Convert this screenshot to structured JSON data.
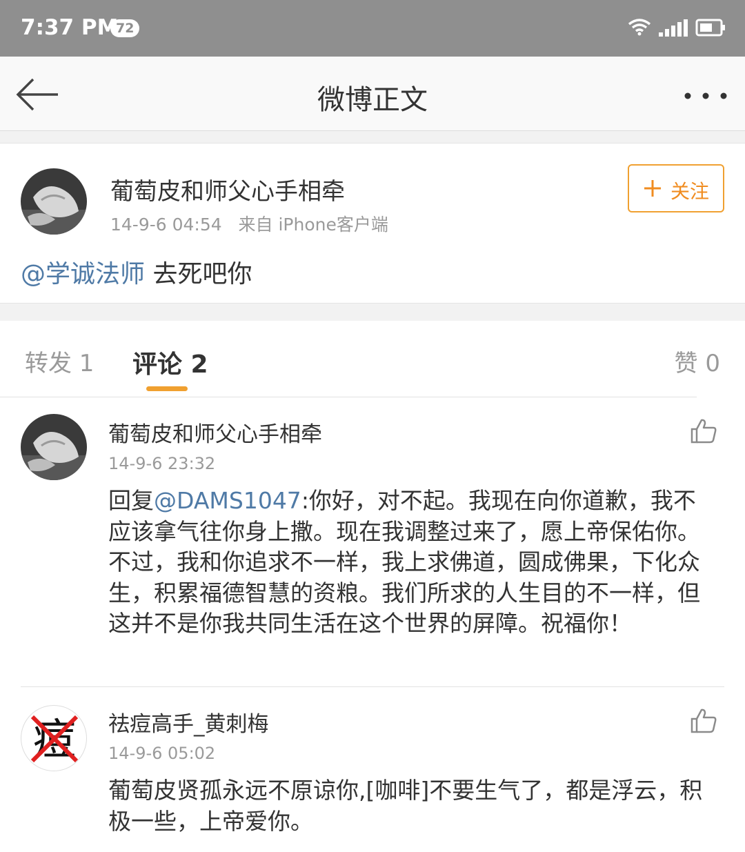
{
  "status_bar": {
    "time": "7:37 PM",
    "badge": "72",
    "icons": [
      "wifi-icon",
      "signal-icon",
      "battery-icon"
    ]
  },
  "nav": {
    "title": "微博正文",
    "back_icon": "back-arrow-icon",
    "more_icon": "more-icon"
  },
  "post": {
    "author": "葡萄皮和师父心手相牵",
    "time": "14-9-6 04:54",
    "source": "来自 iPhone客户端",
    "follow_label": "关注",
    "mention": "@学诚法师",
    "text": " 去死吧你"
  },
  "tabs": {
    "repost": "转发 1",
    "comment": "评论 2",
    "like": "赞 0"
  },
  "comments": [
    {
      "author": "葡萄皮和师父心手相牵",
      "time": "14-9-6 23:32",
      "reply_prefix": "回复",
      "mention": "@DAMS1047",
      "text": ":你好，对不起。我现在向你道歉，我不应该拿气往你身上撒。现在我调整过来了，愿上帝保佑你。不过，我和你追求不一样，我上求佛道，圆成佛果，下化众生，积累福德智慧的资粮。我们所求的人生目的不一样，但这并不是你我共同生活在这个世界的屏障。祝福你！"
    },
    {
      "author": "祛痘高手_黄刺梅",
      "time": "14-9-6 05:02",
      "avatar_char": "痘",
      "text": "葡萄皮贤孤永远不原谅你,[咖啡]不要生气了，都是浮云，积极一些，上帝爱你。"
    }
  ],
  "colors": {
    "status_bar": "#8f8f8f",
    "accent": "#f0a030",
    "link": "#4f7aa6",
    "muted": "#9a9a9a"
  }
}
